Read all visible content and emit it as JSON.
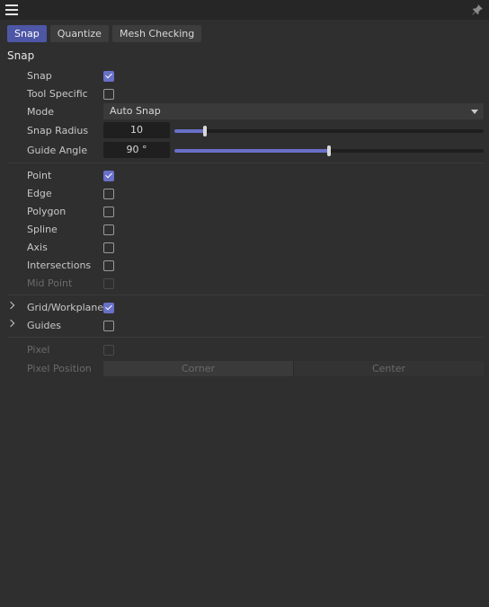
{
  "header": {
    "menu_icon": "hamburger-menu",
    "pin_icon": "pin-icon"
  },
  "tabs": [
    {
      "label": "Snap",
      "active": true
    },
    {
      "label": "Quantize",
      "active": false
    },
    {
      "label": "Mesh Checking",
      "active": false
    }
  ],
  "section": {
    "title": "Snap"
  },
  "settings": {
    "snap": {
      "label": "Snap",
      "checked": true
    },
    "tool_specific": {
      "label": "Tool Specific",
      "checked": false
    },
    "mode": {
      "label": "Mode",
      "value": "Auto Snap"
    },
    "snap_radius": {
      "label": "Snap Radius",
      "value": "10",
      "fraction": 0.1
    },
    "guide_angle": {
      "label": "Guide Angle",
      "value": "90 °",
      "fraction": 0.5
    }
  },
  "snap_targets": [
    {
      "label": "Point",
      "checked": true,
      "enabled": true
    },
    {
      "label": "Edge",
      "checked": false,
      "enabled": true
    },
    {
      "label": "Polygon",
      "checked": false,
      "enabled": true
    },
    {
      "label": "Spline",
      "checked": false,
      "enabled": true
    },
    {
      "label": "Axis",
      "checked": false,
      "enabled": true
    },
    {
      "label": "Intersections",
      "checked": false,
      "enabled": true
    },
    {
      "label": "Mid Point",
      "checked": false,
      "enabled": false
    }
  ],
  "groups": [
    {
      "label": "Grid/Workplane",
      "checked": true
    },
    {
      "label": "Guides",
      "checked": false
    }
  ],
  "pixel": {
    "label": "Pixel",
    "position_label": "Pixel Position",
    "options": [
      "Corner",
      "Center"
    ]
  },
  "colors": {
    "accent": "#6970c8",
    "active_tab": "#4e56a6",
    "background": "#2f2f2f"
  }
}
